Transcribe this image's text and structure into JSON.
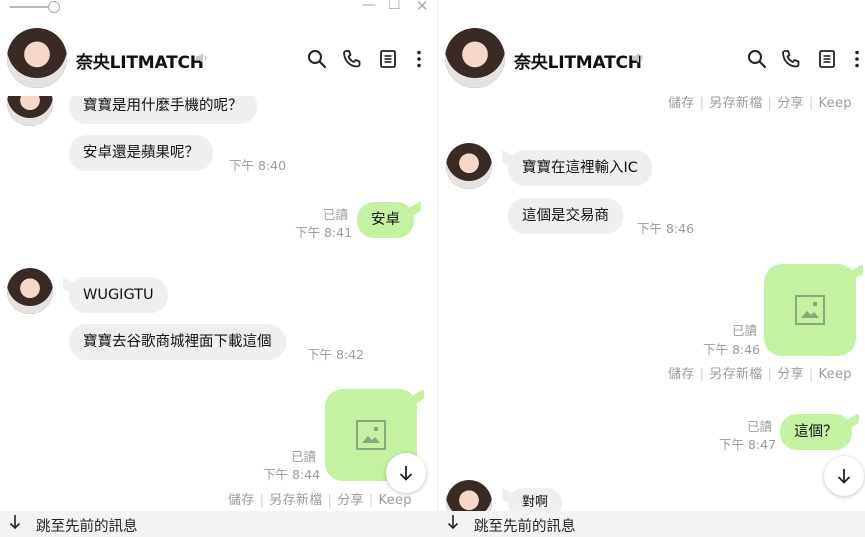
{
  "left_pane": {
    "window_controls": {
      "minimize": "—",
      "maximize": "☐",
      "close": "✕"
    },
    "header": {
      "title": "奈央LITMATCH"
    },
    "messages": [
      {
        "from": "them",
        "text": "寶寶是用什麼手機的呢？"
      },
      {
        "from": "them",
        "text": "安卓還是蘋果呢？",
        "time": "下午 8:40"
      },
      {
        "from": "me",
        "text": "安卓",
        "read": "已讀",
        "time": "下午 8:41"
      },
      {
        "from": "them",
        "text": "WUGIGTU"
      },
      {
        "from": "them",
        "text": "寶寶去谷歌商城裡面下載這個",
        "time": "下午 8:42"
      },
      {
        "from": "me",
        "type": "image",
        "read": "已讀",
        "time": "下午 8:44"
      }
    ],
    "image_actions": [
      "儲存",
      "另存新檔",
      "分享",
      "Keep"
    ],
    "jump_label": "跳至先前的訊息"
  },
  "right_pane": {
    "header": {
      "title": "奈央LITMATCH"
    },
    "top_actions": [
      "儲存",
      "另存新檔",
      "分享",
      "Keep"
    ],
    "messages": [
      {
        "from": "them",
        "text": "寶寶在這裡輸入IC"
      },
      {
        "from": "them",
        "text": "這個是交易商",
        "time": "下午 8:46"
      },
      {
        "from": "me",
        "type": "image",
        "read": "已讀",
        "time": "下午 8:46"
      },
      {
        "from": "me",
        "text": "這個？",
        "read": "已讀",
        "time": "下午 8:47"
      },
      {
        "from": "them",
        "text": "對啊"
      }
    ],
    "image_actions": [
      "儲存",
      "另存新檔",
      "分享",
      "Keep"
    ],
    "jump_label": "跳至先前的訊息"
  },
  "colors": {
    "outgoing_bubble": "#c4f2a2",
    "incoming_bubble": "#efefef",
    "meta_text": "#9b9b9b"
  },
  "icons": [
    "search-icon",
    "phone-icon",
    "notes-icon",
    "more-icon",
    "mute-icon",
    "image-icon",
    "arrow-down-icon"
  ]
}
